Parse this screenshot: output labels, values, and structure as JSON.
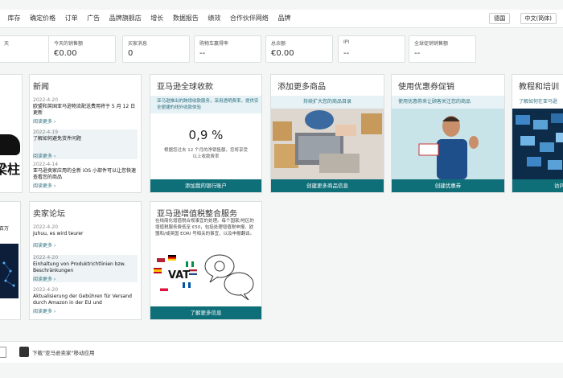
{
  "nav": {
    "items": [
      "家",
      "库存",
      "确定价格",
      "订单",
      "广告",
      "品牌旗舰店",
      "增长",
      "数据报告",
      "绩效",
      "合作伙伴网络",
      "品牌"
    ],
    "region": "德国",
    "language": "中文(简体)"
  },
  "metrics": [
    {
      "label": "天",
      "value": ""
    },
    {
      "label": "今天的销售额",
      "value": "€0.00"
    },
    {
      "label": "买家消息",
      "value": "0"
    },
    {
      "label": "购物车赢得率",
      "value": "--"
    },
    {
      "label": "总余额",
      "value": "€0.00"
    },
    {
      "label": "IPI",
      "value": "--"
    },
    {
      "label": "全球促销销售额",
      "value": "--"
    }
  ],
  "news": {
    "title": "新闻",
    "items": [
      {
        "date": "2022-4-20",
        "title": "欧盟和英国亚马逊物流配送费用将于 5 月 12 日更新",
        "more": "阅读更多 ›"
      },
      {
        "date": "2022-4-19",
        "title": "了解如何避免货件问题",
        "more": "阅读更多 ›"
      },
      {
        "date": "2022-4-14",
        "title": "亚马逊卖家应用的全新 iOS 小部件可以让您快速查看您的商品",
        "more": "阅读更多 ›"
      }
    ]
  },
  "leftcard": {
    "text": "梁柱",
    "caption": "百万"
  },
  "forum": {
    "title": "卖家论坛",
    "items": [
      {
        "date": "2022-4-20",
        "title": "Juhuu, es wird teurer",
        "more": "阅读更多 ›"
      },
      {
        "date": "2022-4-20",
        "title": "Einhaltung von Produktrichtlinien bzw. Beschränkungen",
        "more": "阅读更多 ›"
      },
      {
        "date": "2022-4-20",
        "title": "Aktualisierung der Gebühren für Versand durch Amazon in der EU und",
        "more": "阅读更多 ›"
      }
    ]
  },
  "global": {
    "title": "亚马逊全球收款",
    "banner": "亚马逊推出的跨境收款服务，采用透明费率，提供安全便捷的线外收款体验",
    "rate": "0,9 %",
    "desc": "根据您过去 12 个月的净销售额，您将享受以上收款费率",
    "cta": "添加我的银行账户"
  },
  "vat": {
    "title": "亚马逊增值税整合服务",
    "desc": "在线简化增值税合规事宜的处理。每个国家/地区的增值税服务费低至 €50，包括处理增值税申报、欧盟和/或英国 EORI 号相关的事宜，以及申报翻译。",
    "badge": "VAT",
    "cta": "了解更多信息"
  },
  "products": {
    "title": "添加更多商品",
    "banner": "持续扩大您的商品目录",
    "cta": "创建更多商品信息"
  },
  "coupons": {
    "title": "使用优惠券促销",
    "banner": "使用优惠券来让顾客关注您的商品",
    "cta": "创建优惠券"
  },
  "tutorials": {
    "title": "教程和培训",
    "banner": "了解如何在亚马逊",
    "cta": "访问"
  },
  "footer": {
    "app_link": "下载\"亚马逊卖家\"移动应用"
  },
  "colors": {
    "accent": "#0f6f79",
    "banner_bg": "#e6f2f5"
  }
}
